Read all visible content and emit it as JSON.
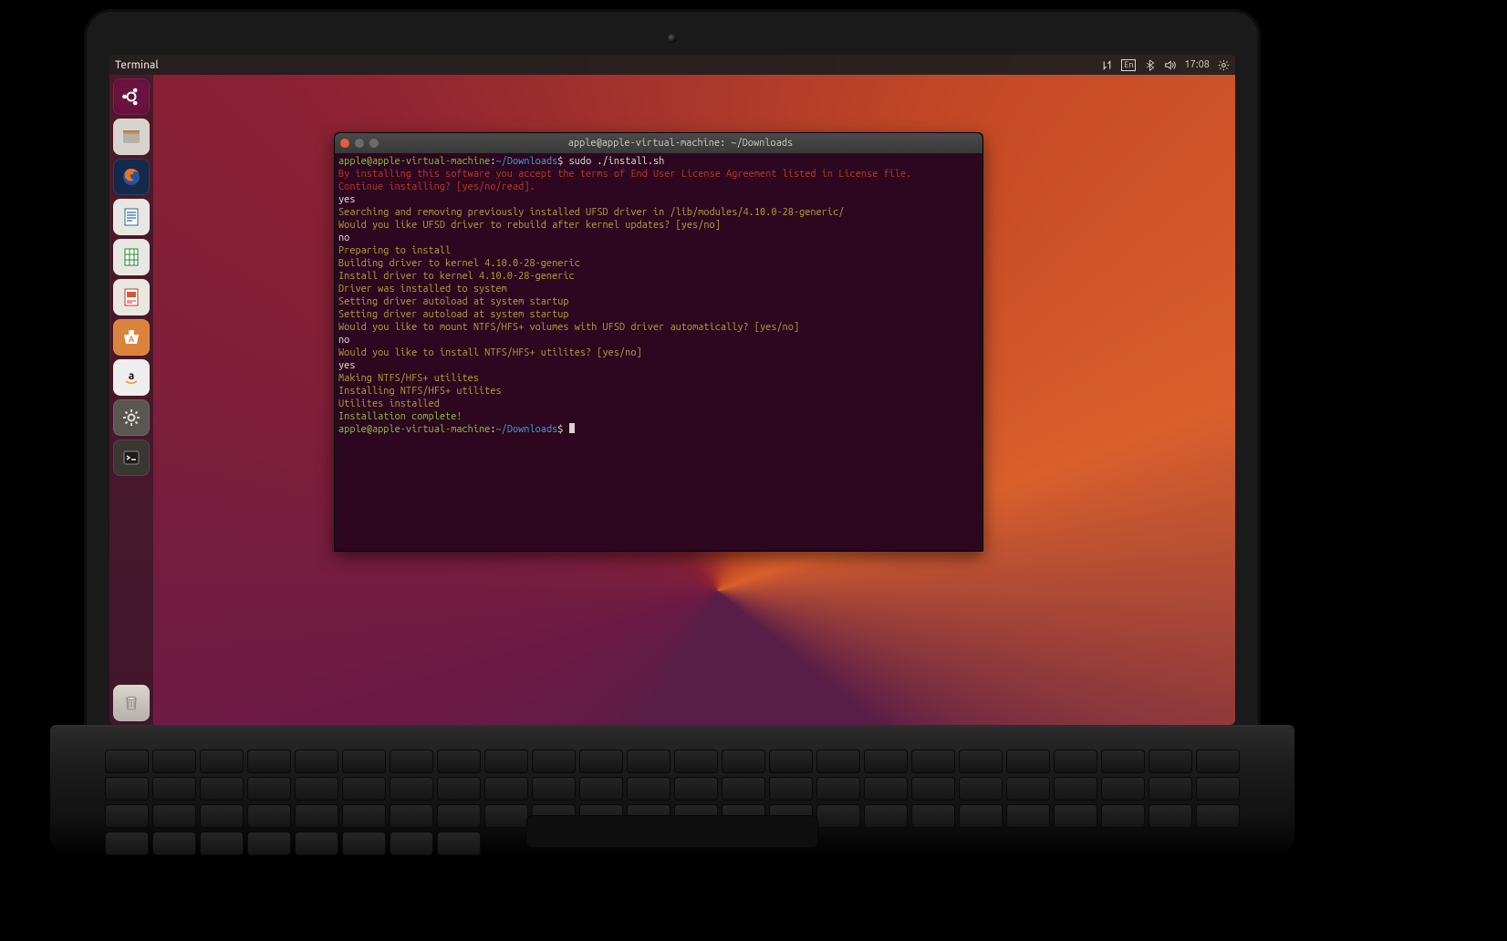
{
  "menubar": {
    "title": "Terminal",
    "lang": "En",
    "clock": "17:08"
  },
  "launcher": {
    "items": [
      "ubuntu-dash",
      "file-manager",
      "firefox",
      "writer",
      "calc",
      "impress",
      "software",
      "amazon",
      "settings",
      "terminal"
    ],
    "trash": "trash"
  },
  "terminal": {
    "title": "apple@apple-virtual-machine: ~/Downloads",
    "prompt": {
      "user_host": "apple@apple-virtual-machine",
      "sep1": ":",
      "path": "~/Downloads",
      "sep2": "$ "
    },
    "command": "sudo ./install.sh",
    "lines": [
      {
        "cls": "c-red",
        "text": "By installing this software you accept the terms of End User License Agreement listed in License file."
      },
      {
        "cls": "c-red",
        "text": "Continue installing? [yes/no/read]."
      },
      {
        "cls": "c-white",
        "text": "yes"
      },
      {
        "cls": "c-yel",
        "text": "Searching and removing previously installed UFSD driver in /lib/modules/4.10.0-28-generic/"
      },
      {
        "cls": "c-yel",
        "text": "Would you like UFSD driver to rebuild after kernel updates? [yes/no]"
      },
      {
        "cls": "c-white",
        "text": "no"
      },
      {
        "cls": "c-yel",
        "text": "Preparing to install"
      },
      {
        "cls": "c-yel",
        "text": "Building driver to kernel 4.10.0-28-generic"
      },
      {
        "cls": "c-yel",
        "text": "Install driver to kernel 4.10.0-28-generic"
      },
      {
        "cls": "c-yel",
        "text": "Driver was installed to system"
      },
      {
        "cls": "c-yel",
        "text": "Setting driver autoload at system startup"
      },
      {
        "cls": "c-yel",
        "text": "Setting driver autoload at system startup"
      },
      {
        "cls": "c-yel",
        "text": "Would you like to mount NTFS/HFS+ volumes with UFSD driver automatically? [yes/no]"
      },
      {
        "cls": "c-white",
        "text": "no"
      },
      {
        "cls": "c-yel",
        "text": "Would you like to install NTFS/HFS+ utilites? [yes/no]"
      },
      {
        "cls": "c-white",
        "text": "yes"
      },
      {
        "cls": "c-yel",
        "text": "Making NTFS/HFS+ utilites"
      },
      {
        "cls": "c-yel",
        "text": "Installing NTFS/HFS+ utilites"
      },
      {
        "cls": "c-yel",
        "text": "Utilites installed"
      },
      {
        "cls": "c-green",
        "text": "Installation complete!"
      }
    ]
  }
}
